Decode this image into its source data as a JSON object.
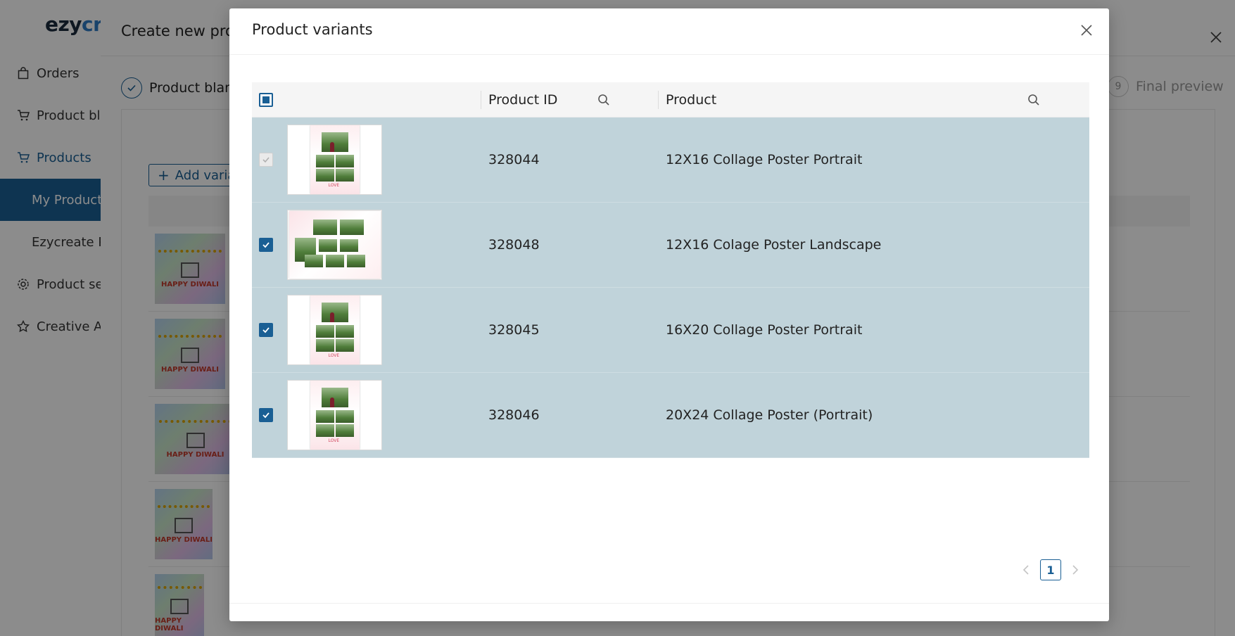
{
  "app": {
    "logo_part1": "ezy",
    "logo_part2": "create",
    "nav": [
      {
        "label": "Orders"
      },
      {
        "label": "Product blanks"
      },
      {
        "label": "Products"
      },
      {
        "label": "My Products"
      },
      {
        "label": "Ezycreate Products"
      },
      {
        "label": "Product settings"
      },
      {
        "label": "Creative Assets"
      }
    ]
  },
  "drawer": {
    "title": "Create new product",
    "step_first": "Product blank",
    "step_last_number": "9",
    "step_last": "Final preview",
    "add_variant_label": "Add variant",
    "thumb_text": "HAPPY DIWALI"
  },
  "modal": {
    "title": "Product variants",
    "columns": {
      "product_id": "Product ID",
      "product": "Product"
    },
    "rows": [
      {
        "id": "328044",
        "name": "12X16 Collage Poster Portrait",
        "checked": true,
        "disabled": true,
        "orientation": "portrait"
      },
      {
        "id": "328048",
        "name": "12X16 Colage Poster Landscape",
        "checked": true,
        "disabled": false,
        "orientation": "landscape"
      },
      {
        "id": "328045",
        "name": "16X20 Collage Poster Portrait",
        "checked": true,
        "disabled": false,
        "orientation": "portrait"
      },
      {
        "id": "328046",
        "name": "20X24 Collage Poster (Portrait)",
        "checked": true,
        "disabled": false,
        "orientation": "portrait"
      }
    ],
    "thumb_caption": "LOVE",
    "pagination": {
      "current": "1"
    }
  },
  "colors": {
    "accent": "#1a5f94",
    "selected_row": "#c0d3da",
    "overlay": "rgba(0,0,0,0.45)"
  }
}
